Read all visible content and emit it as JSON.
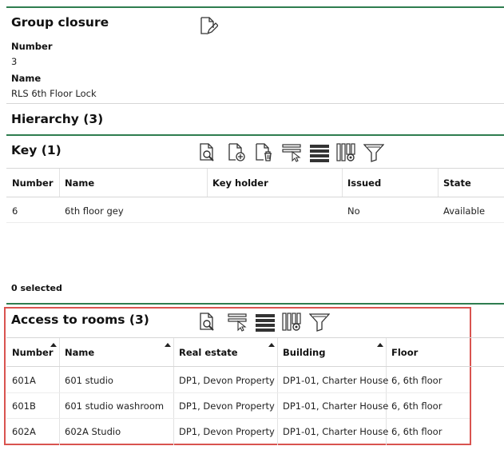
{
  "group_closure": {
    "title": "Group closure",
    "number_label": "Number",
    "number_value": "3",
    "name_label": "Name",
    "name_value": "RLS 6th Floor Lock"
  },
  "hierarchy": {
    "title": "Hierarchy (3)"
  },
  "key_section": {
    "title": "Key (1)",
    "columns": [
      "Number",
      "Name",
      "Key holder",
      "Issued",
      "State"
    ],
    "rows": [
      {
        "number": "6",
        "name": "6th floor gey",
        "key_holder": "",
        "issued": "No",
        "state": "Available"
      }
    ],
    "selected_text": "0 selected"
  },
  "access_rooms": {
    "title": "Access to rooms (3)",
    "columns": [
      "Number",
      "Name",
      "Real estate",
      "Building",
      "Floor"
    ],
    "rows": [
      {
        "number": "601A",
        "name": "601 studio",
        "real_estate": "DP1, Devon Property",
        "building": "DP1-01, Charter House",
        "floor": "6, 6th floor"
      },
      {
        "number": "601B",
        "name": "601 studio washroom",
        "real_estate": "DP1, Devon Property",
        "building": "DP1-01, Charter House",
        "floor": "6, 6th floor"
      },
      {
        "number": "602A",
        "name": "602A Studio",
        "real_estate": "DP1, Devon Property",
        "building": "DP1-01, Charter House",
        "floor": "6, 6th floor"
      }
    ]
  },
  "colors": {
    "accent_green": "#2e7d4f",
    "highlight_red": "#d9534f"
  }
}
